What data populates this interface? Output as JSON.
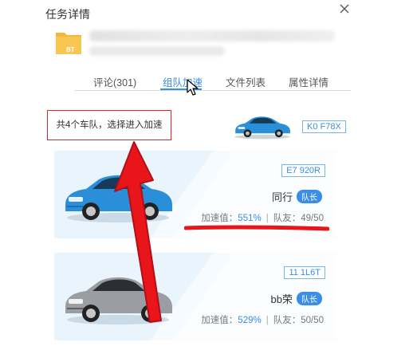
{
  "dialog": {
    "title": "任务详情"
  },
  "file": {
    "type_label": "BT"
  },
  "tabs": [
    {
      "label": "评论(301)",
      "active": false
    },
    {
      "label": "组队加速",
      "active": true
    },
    {
      "label": "文件列表",
      "active": false
    },
    {
      "label": "属性详情",
      "active": false
    }
  ],
  "team_info": {
    "notice": "共4个车队，选择进入加速",
    "my_plate": "K0 F78X"
  },
  "teams": [
    {
      "plate": "E7 920R",
      "name": "同行",
      "badge": "队长",
      "speed_label": "加速值：",
      "speed_value": "551%",
      "sep": "|",
      "members_label": "队友：",
      "members": "49/50",
      "car_color": "#2a8fd8"
    },
    {
      "plate": "11 1L6T",
      "name": "bb荣",
      "badge": "队长",
      "speed_label": "加速值：",
      "speed_value": "529%",
      "sep": "|",
      "members_label": "队友：",
      "members": "50/50",
      "car_color": "#9a9ea3"
    }
  ],
  "colors": {
    "accent": "#3a8ee6",
    "annotation": "#d9262c",
    "card_bg": "#e9f4fd"
  },
  "icons": {
    "close": "close-icon",
    "folder": "folder-icon"
  }
}
